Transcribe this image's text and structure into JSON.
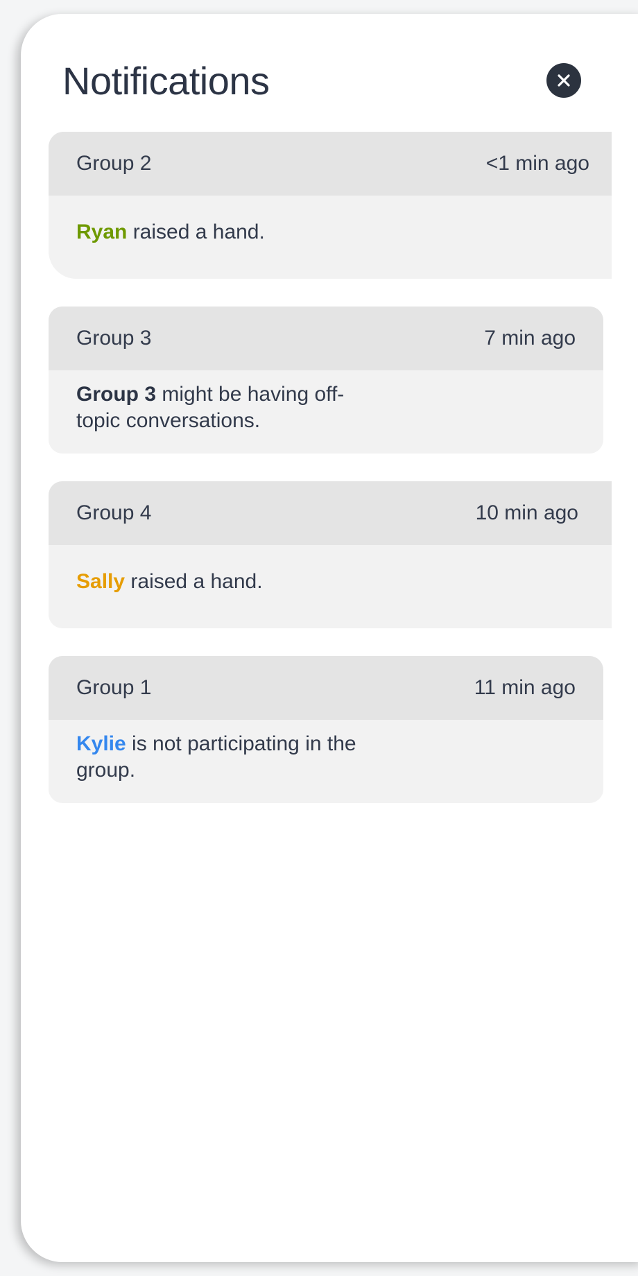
{
  "panel": {
    "title": "Notifications",
    "close_icon": "close-icon"
  },
  "notifications": [
    {
      "group": "Group 2",
      "time": "<1 min ago",
      "subject": "Ryan",
      "message": " raised a hand.",
      "subject_color": "#6e9900"
    },
    {
      "group": "Group 3",
      "time": "7 min ago",
      "subject": "Group 3",
      "message": " might be having off-topic conversations.",
      "subject_color": "#2c3445"
    },
    {
      "group": "Group 4",
      "time": "10 min ago",
      "subject": "Sally",
      "message": " raised a hand.",
      "subject_color": "#e69d05"
    },
    {
      "group": "Group 1",
      "time": "11 min ago",
      "subject": "Kylie",
      "message": " is not participating in the group.",
      "subject_color": "#3487ee"
    }
  ],
  "colors": {
    "header_bg": "#e4e4e4",
    "card_bg": "#f2f2f2",
    "close_button_bg": "#2c333f"
  }
}
